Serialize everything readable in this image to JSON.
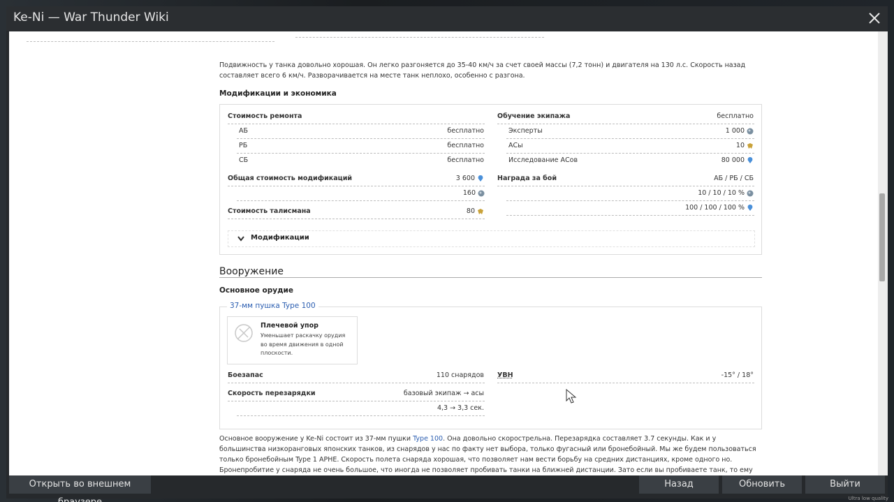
{
  "window": {
    "title": "Ke-Ni — War Thunder Wiki"
  },
  "mobility_text": "Подвижность у танка довольно хорошая. Он легко разгоняется до 35-40 км/ч за счет своей массы (7,2 тонн) и двигателя на 130 л.с. Скорость назад составляет всего 6 км/ч. Разворачивается на месте танк неплохо, особенно с разгона.",
  "economy": {
    "heading": "Модификации и экономика",
    "repair_cost": {
      "label": "Стоимость ремонта",
      "ab_label": "АБ",
      "ab": "бесплатно",
      "rb_label": "РБ",
      "rb": "бесплатно",
      "sb_label": "СБ",
      "sb": "бесплатно"
    },
    "modifications_cost": {
      "label": "Общая стоимость модификаций",
      "silver": "3 600",
      "rp": "160"
    },
    "talisman": {
      "label": "Стоимость талисмана",
      "value": "80"
    },
    "crew": {
      "label": "Обучение экипажа",
      "value": "бесплатно",
      "experts_label": "Эксперты",
      "experts": "1 000",
      "aces_label": "АСы",
      "aces": "10",
      "research_label": "Исследование АСов",
      "research": "80 000"
    },
    "reward": {
      "label": "Награда за бой",
      "modes": "АБ / РБ / СБ",
      "rp": "10 / 10 / 10 %",
      "silver": "100 / 100 / 100 %"
    },
    "modifications_toggle": "Модификации"
  },
  "armament": {
    "heading": "Вооружение",
    "main_gun_heading": "Основное орудие",
    "gun_name": "37-мм пушка Type 100",
    "feature": {
      "title": "Плечевой упор",
      "desc": "Уменьшает раскачку орудия во время движения в одной плоскости."
    },
    "ammo": {
      "label": "Боезапас",
      "value": "110 снарядов"
    },
    "reload": {
      "label": "Скорость перезарядки",
      "value": "базовый экипаж → асы",
      "time": "4,3 → 3,3 сек."
    },
    "elevation": {
      "label": "УВН",
      "value": "-15° / 18°"
    },
    "description_parts": {
      "a": "Основное вооружение у Ke-Ni состоит из 37-мм пушки ",
      "link": "Type 100",
      "b": ". Она довольно скорострельна. Перезарядка составляет 3.7 секунды. Как и у большинства низкоранговых японских танков, из снарядов у нас по факту нет выбора, только фугасный или бронебойный. Мы же будем пользоваться только бронебойным Type 1 APHE. Скорость полета снаряда хорошая, что позволяет нам вести борьбу на средних дистанциях, кроме одного но. Бронепробитие у снаряда не очень большое, что иногда не позволяет пробивать танки на ближней дистанции. Зато если вы пробиваете танк, то ему вряд ли хорошо. Взрывчатого вещества хоть и мало, часто у вас будут ваншоты или критическое"
    }
  },
  "buttons": {
    "external": "Открыть во внешнем браузере",
    "back": "Назад",
    "refresh": "Обновить",
    "exit": "Выйти"
  },
  "quality_label": "Ultra low quality",
  "colors": {
    "silver_icon": "#7a8fa0",
    "rp_icon": "#4a90d9",
    "gold_icon": "#c9a23a"
  }
}
